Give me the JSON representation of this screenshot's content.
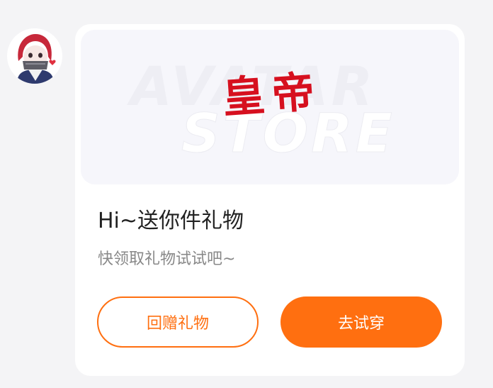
{
  "message": {
    "banner": {
      "watermark_line1": "AVATAR",
      "watermark_line2": "STORE",
      "brand_text": "皇帝"
    },
    "title": "Hi~送你件礼物",
    "subtitle": "快领取礼物试试吧~",
    "buttons": {
      "return_gift": "回赠礼物",
      "try_on": "去试穿"
    }
  },
  "colors": {
    "accent": "#ff6f10",
    "brand_red": "#d6101f",
    "page_background": "#f4f4f6",
    "card_background": "#ffffff"
  }
}
